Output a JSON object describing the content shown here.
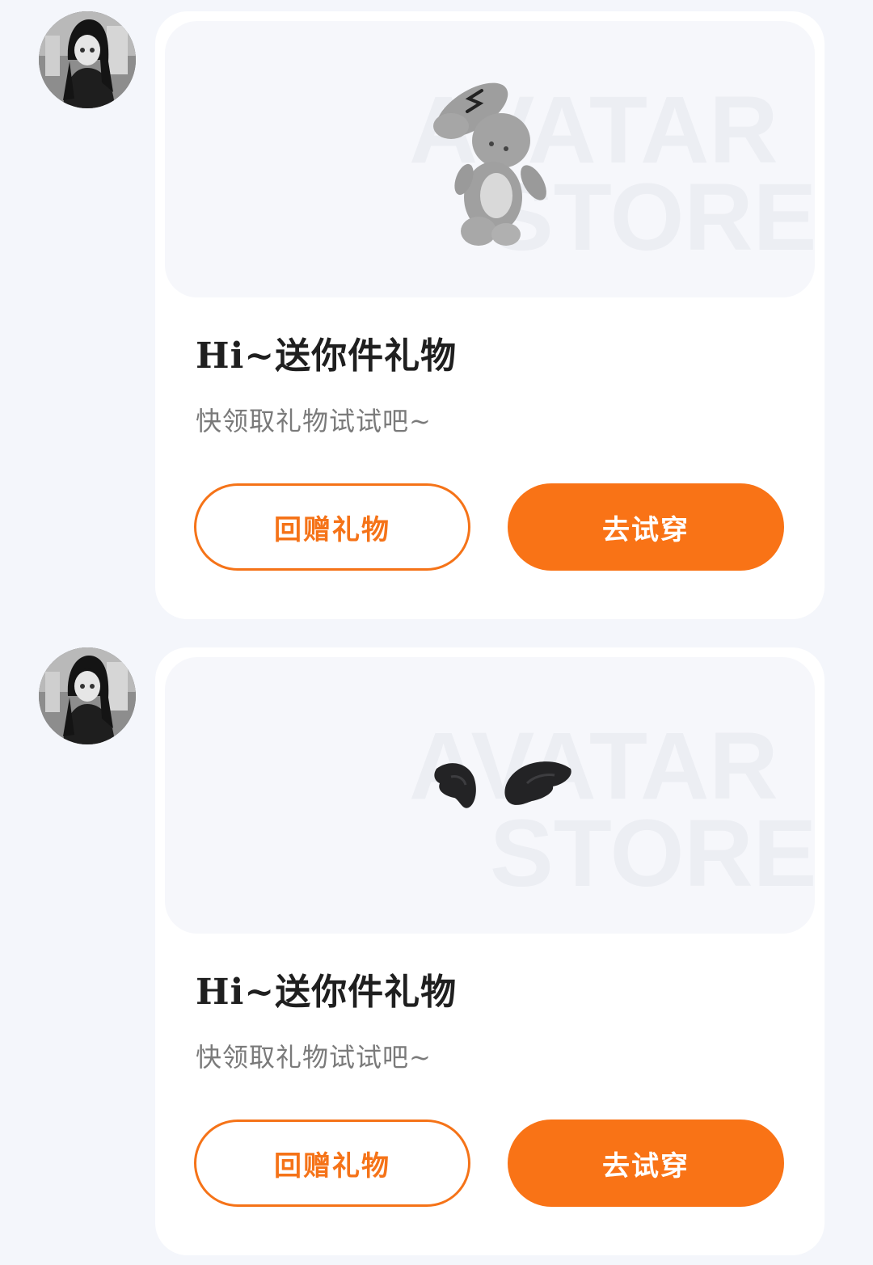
{
  "colors": {
    "accent": "#f97316",
    "page_bg": "#f4f6fb",
    "card_bg": "#ffffff"
  },
  "messages": [
    {
      "item_icon": "gray-bunny-plush-icon",
      "title": "Hi~送你件礼物",
      "subtitle": "快领取礼物试试吧~",
      "gift_back_label": "回赠礼物",
      "try_on_label": "去试穿"
    },
    {
      "item_icon": "black-wings-icon",
      "title": "Hi~送你件礼物",
      "subtitle": "快领取礼物试试吧~",
      "gift_back_label": "回赠礼物",
      "try_on_label": "去试穿"
    }
  ]
}
